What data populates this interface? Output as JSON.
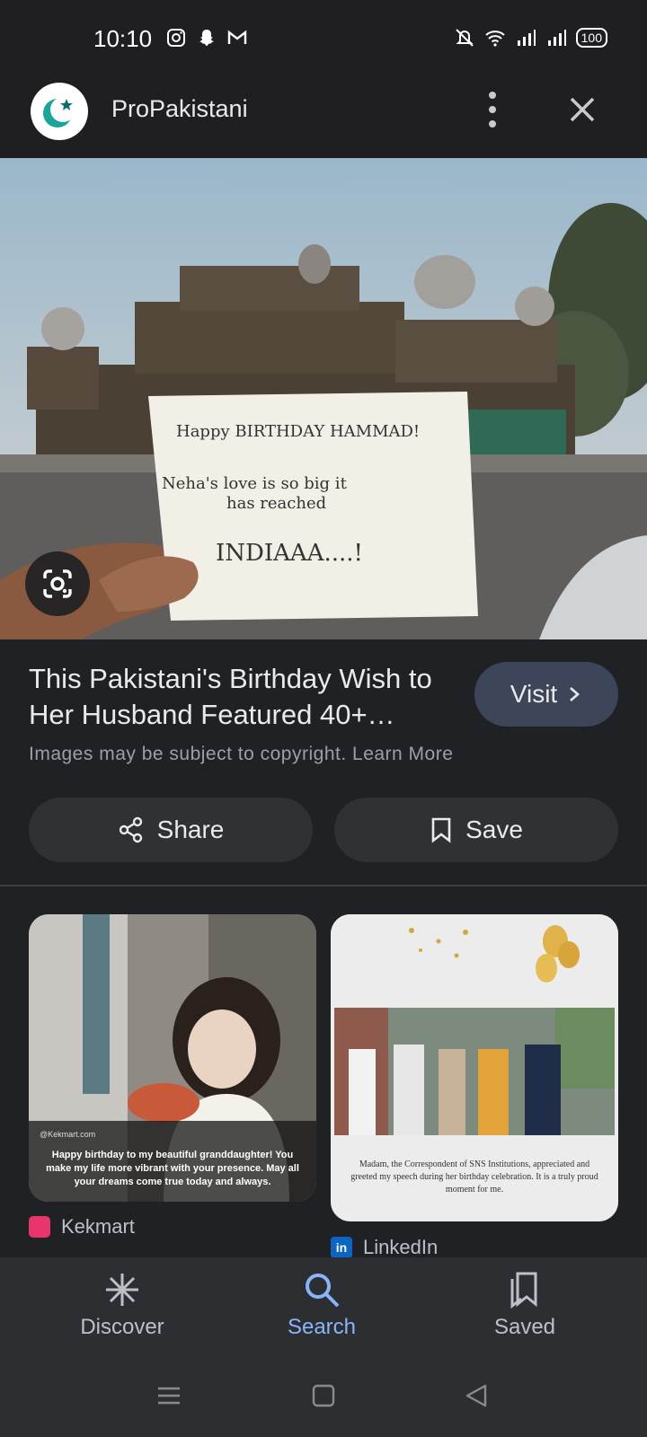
{
  "status_bar": {
    "time": "10:10",
    "battery": "100",
    "left_icons": [
      "instagram-icon",
      "snapchat-icon",
      "gmail-icon"
    ],
    "right_icons": [
      "mute-icon",
      "wifi-icon",
      "signal-icon",
      "signal-icon"
    ]
  },
  "header": {
    "site_name": "ProPakistani"
  },
  "result": {
    "title": "This Pakistani's Birthday Wish to Her Husband Featured 40+…",
    "visit_label": "Visit",
    "copyright_text": "Images may be subject to copyright.",
    "learn_more": "Learn More"
  },
  "main_image": {
    "note_line1": "Happy BIRTHDAY HAMMAD!",
    "note_line2": "Neha's love is so big it",
    "note_line3": "has reached",
    "note_line4": "INDIAAA....!"
  },
  "actions": {
    "share_label": "Share",
    "save_label": "Save"
  },
  "related": [
    {
      "brand": "@Kekmart.com",
      "caption": "Happy birthday to my beautiful granddaughter! You make my life more vibrant with your presence. May all your dreams come true today and always.",
      "source": "Kekmart"
    },
    {
      "caption": "Madam, the Correspondent of SNS Institutions, appreciated and greeted my speech during her birthday celebration. It is a truly proud moment for me.",
      "source": "LinkedIn"
    }
  ],
  "bottom_nav": {
    "discover": "Discover",
    "search": "Search",
    "saved": "Saved"
  },
  "colors": {
    "background": "#202124",
    "accent": "#8ab4f8",
    "visit_button": "#3c4658"
  }
}
